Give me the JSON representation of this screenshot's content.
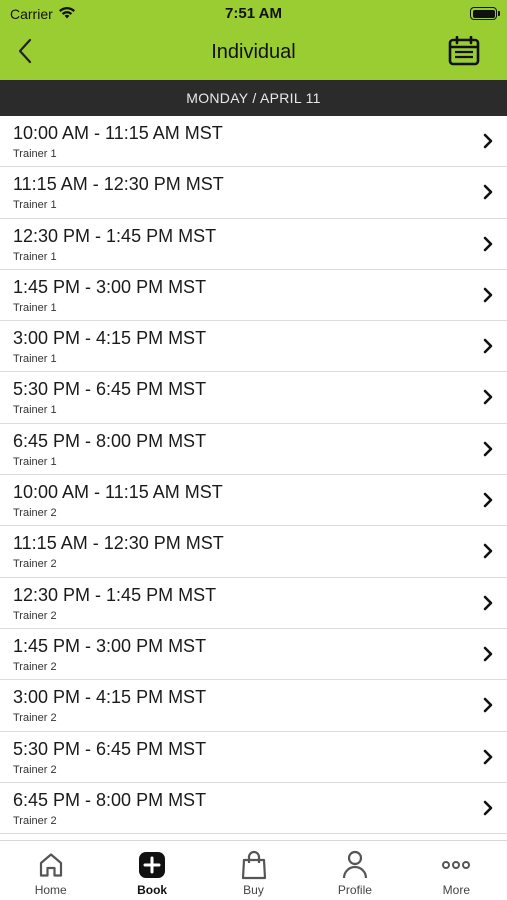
{
  "status_bar": {
    "carrier": "Carrier",
    "time": "7:51 AM",
    "battery_level": 1.0
  },
  "nav": {
    "title": "Individual",
    "back_icon": "chevron-left-icon",
    "calendar_icon": "calendar-icon"
  },
  "date_header": "MONDAY / APRIL 11",
  "colors": {
    "header": "#9acd32",
    "date_bar": "#2b2b2b"
  },
  "slots": [
    {
      "time": "10:00 AM - 11:15 AM MST",
      "trainer": "Trainer 1"
    },
    {
      "time": "11:15 AM - 12:30 PM MST",
      "trainer": "Trainer 1"
    },
    {
      "time": "12:30 PM - 1:45 PM MST",
      "trainer": "Trainer 1"
    },
    {
      "time": "1:45 PM - 3:00 PM MST",
      "trainer": "Trainer 1"
    },
    {
      "time": "3:00 PM - 4:15 PM MST",
      "trainer": "Trainer 1"
    },
    {
      "time": "5:30 PM - 6:45 PM MST",
      "trainer": "Trainer 1"
    },
    {
      "time": "6:45 PM - 8:00 PM MST",
      "trainer": "Trainer 1"
    },
    {
      "time": "10:00 AM - 11:15 AM MST",
      "trainer": "Trainer 2"
    },
    {
      "time": "11:15 AM - 12:30 PM MST",
      "trainer": "Trainer 2"
    },
    {
      "time": "12:30 PM - 1:45 PM MST",
      "trainer": "Trainer 2"
    },
    {
      "time": "1:45 PM - 3:00 PM MST",
      "trainer": "Trainer 2"
    },
    {
      "time": "3:00 PM - 4:15 PM MST",
      "trainer": "Trainer 2"
    },
    {
      "time": "5:30 PM - 6:45 PM MST",
      "trainer": "Trainer 2"
    },
    {
      "time": "6:45 PM - 8:00 PM MST",
      "trainer": "Trainer 2"
    }
  ],
  "tabs": [
    {
      "label": "Home",
      "icon": "home-icon",
      "active": false
    },
    {
      "label": "Book",
      "icon": "plus-square-icon",
      "active": true
    },
    {
      "label": "Buy",
      "icon": "shopping-bag-icon",
      "active": false
    },
    {
      "label": "Profile",
      "icon": "person-icon",
      "active": false
    },
    {
      "label": "More",
      "icon": "more-dots-icon",
      "active": false
    }
  ]
}
